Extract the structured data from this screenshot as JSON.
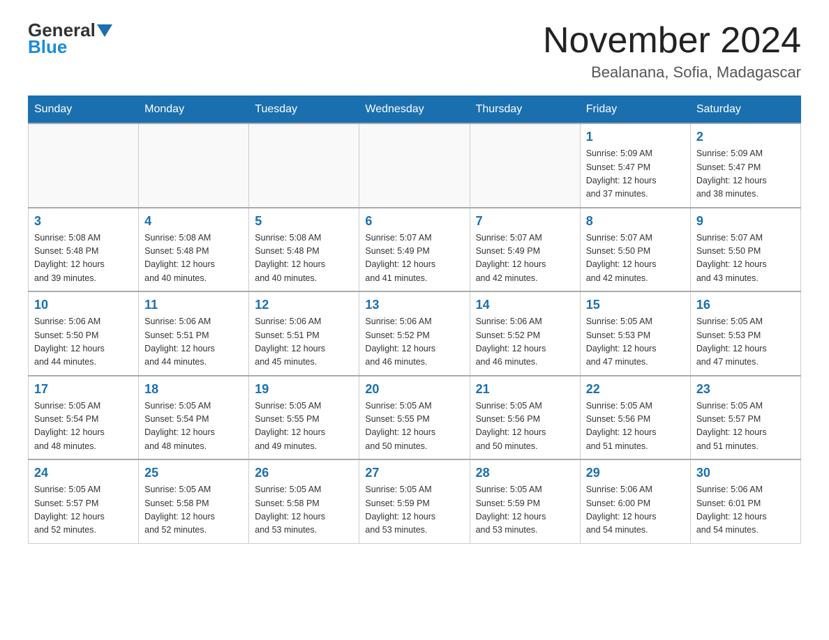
{
  "header": {
    "logo_general": "General",
    "logo_blue": "Blue",
    "title": "November 2024",
    "subtitle": "Bealanana, Sofia, Madagascar"
  },
  "weekdays": [
    "Sunday",
    "Monday",
    "Tuesday",
    "Wednesday",
    "Thursday",
    "Friday",
    "Saturday"
  ],
  "weeks": [
    [
      {
        "day": "",
        "info": ""
      },
      {
        "day": "",
        "info": ""
      },
      {
        "day": "",
        "info": ""
      },
      {
        "day": "",
        "info": ""
      },
      {
        "day": "",
        "info": ""
      },
      {
        "day": "1",
        "info": "Sunrise: 5:09 AM\nSunset: 5:47 PM\nDaylight: 12 hours\nand 37 minutes."
      },
      {
        "day": "2",
        "info": "Sunrise: 5:09 AM\nSunset: 5:47 PM\nDaylight: 12 hours\nand 38 minutes."
      }
    ],
    [
      {
        "day": "3",
        "info": "Sunrise: 5:08 AM\nSunset: 5:48 PM\nDaylight: 12 hours\nand 39 minutes."
      },
      {
        "day": "4",
        "info": "Sunrise: 5:08 AM\nSunset: 5:48 PM\nDaylight: 12 hours\nand 40 minutes."
      },
      {
        "day": "5",
        "info": "Sunrise: 5:08 AM\nSunset: 5:48 PM\nDaylight: 12 hours\nand 40 minutes."
      },
      {
        "day": "6",
        "info": "Sunrise: 5:07 AM\nSunset: 5:49 PM\nDaylight: 12 hours\nand 41 minutes."
      },
      {
        "day": "7",
        "info": "Sunrise: 5:07 AM\nSunset: 5:49 PM\nDaylight: 12 hours\nand 42 minutes."
      },
      {
        "day": "8",
        "info": "Sunrise: 5:07 AM\nSunset: 5:50 PM\nDaylight: 12 hours\nand 42 minutes."
      },
      {
        "day": "9",
        "info": "Sunrise: 5:07 AM\nSunset: 5:50 PM\nDaylight: 12 hours\nand 43 minutes."
      }
    ],
    [
      {
        "day": "10",
        "info": "Sunrise: 5:06 AM\nSunset: 5:50 PM\nDaylight: 12 hours\nand 44 minutes."
      },
      {
        "day": "11",
        "info": "Sunrise: 5:06 AM\nSunset: 5:51 PM\nDaylight: 12 hours\nand 44 minutes."
      },
      {
        "day": "12",
        "info": "Sunrise: 5:06 AM\nSunset: 5:51 PM\nDaylight: 12 hours\nand 45 minutes."
      },
      {
        "day": "13",
        "info": "Sunrise: 5:06 AM\nSunset: 5:52 PM\nDaylight: 12 hours\nand 46 minutes."
      },
      {
        "day": "14",
        "info": "Sunrise: 5:06 AM\nSunset: 5:52 PM\nDaylight: 12 hours\nand 46 minutes."
      },
      {
        "day": "15",
        "info": "Sunrise: 5:05 AM\nSunset: 5:53 PM\nDaylight: 12 hours\nand 47 minutes."
      },
      {
        "day": "16",
        "info": "Sunrise: 5:05 AM\nSunset: 5:53 PM\nDaylight: 12 hours\nand 47 minutes."
      }
    ],
    [
      {
        "day": "17",
        "info": "Sunrise: 5:05 AM\nSunset: 5:54 PM\nDaylight: 12 hours\nand 48 minutes."
      },
      {
        "day": "18",
        "info": "Sunrise: 5:05 AM\nSunset: 5:54 PM\nDaylight: 12 hours\nand 48 minutes."
      },
      {
        "day": "19",
        "info": "Sunrise: 5:05 AM\nSunset: 5:55 PM\nDaylight: 12 hours\nand 49 minutes."
      },
      {
        "day": "20",
        "info": "Sunrise: 5:05 AM\nSunset: 5:55 PM\nDaylight: 12 hours\nand 50 minutes."
      },
      {
        "day": "21",
        "info": "Sunrise: 5:05 AM\nSunset: 5:56 PM\nDaylight: 12 hours\nand 50 minutes."
      },
      {
        "day": "22",
        "info": "Sunrise: 5:05 AM\nSunset: 5:56 PM\nDaylight: 12 hours\nand 51 minutes."
      },
      {
        "day": "23",
        "info": "Sunrise: 5:05 AM\nSunset: 5:57 PM\nDaylight: 12 hours\nand 51 minutes."
      }
    ],
    [
      {
        "day": "24",
        "info": "Sunrise: 5:05 AM\nSunset: 5:57 PM\nDaylight: 12 hours\nand 52 minutes."
      },
      {
        "day": "25",
        "info": "Sunrise: 5:05 AM\nSunset: 5:58 PM\nDaylight: 12 hours\nand 52 minutes."
      },
      {
        "day": "26",
        "info": "Sunrise: 5:05 AM\nSunset: 5:58 PM\nDaylight: 12 hours\nand 53 minutes."
      },
      {
        "day": "27",
        "info": "Sunrise: 5:05 AM\nSunset: 5:59 PM\nDaylight: 12 hours\nand 53 minutes."
      },
      {
        "day": "28",
        "info": "Sunrise: 5:05 AM\nSunset: 5:59 PM\nDaylight: 12 hours\nand 53 minutes."
      },
      {
        "day": "29",
        "info": "Sunrise: 5:06 AM\nSunset: 6:00 PM\nDaylight: 12 hours\nand 54 minutes."
      },
      {
        "day": "30",
        "info": "Sunrise: 5:06 AM\nSunset: 6:01 PM\nDaylight: 12 hours\nand 54 minutes."
      }
    ]
  ]
}
